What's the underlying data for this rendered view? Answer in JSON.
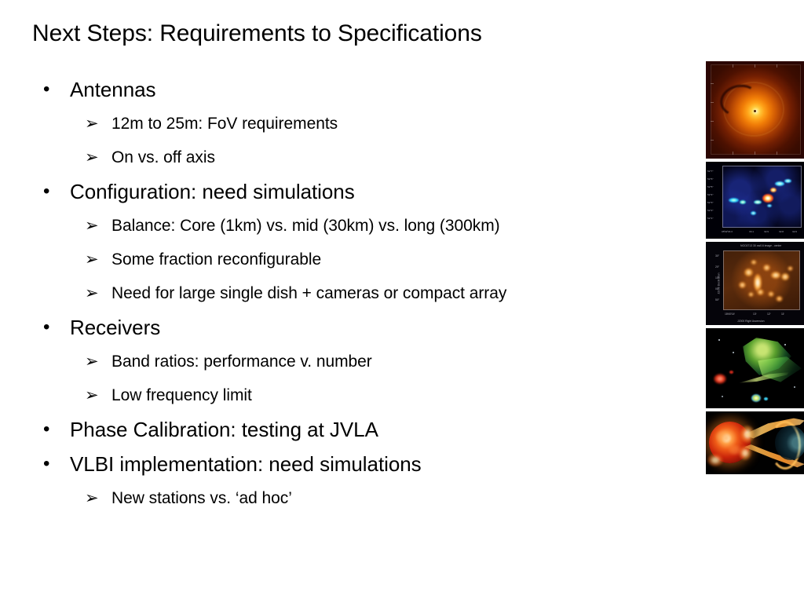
{
  "slide": {
    "title": "Next Steps: Requirements to Specifications",
    "bullet_glyph": "•",
    "sub_bullet_glyph": "➢",
    "background_color": "#ffffff",
    "text_color": "#000000",
    "outline": [
      {
        "level": 1,
        "text": "Antennas"
      },
      {
        "level": 2,
        "text": "12m to 25m: FoV requirements"
      },
      {
        "level": 2,
        "text": "On vs. off axis"
      },
      {
        "level": 1,
        "text": "Configuration: need simulations"
      },
      {
        "level": 2,
        "text": "Balance: Core (1km) vs. mid (30km) vs. long (300km)"
      },
      {
        "level": 2,
        "text": "Some fraction reconfigurable"
      },
      {
        "level": 2,
        "text": "Need for large single dish + cameras or compact array"
      },
      {
        "level": 1,
        "text": "Receivers"
      },
      {
        "level": 2,
        "text": "Band ratios: performance v. number"
      },
      {
        "level": 2,
        "text": "Low frequency limit"
      },
      {
        "level": 1,
        "text": "Phase Calibration: testing at JVLA"
      },
      {
        "level": 1,
        "text": "VLBI implementation: need simulations"
      },
      {
        "level": 2,
        "text": "New stations vs. ‘ad hoc’"
      }
    ]
  },
  "image_strip": {
    "figures": [
      {
        "name": "protoplanetary-disk",
        "description": "Protoplanetary disk: bright yellow-white core with orange rings and a dark spiral gap",
        "dominant_colors": [
          "#ffe67a",
          "#ffa218",
          "#a33a03",
          "#300901"
        ]
      },
      {
        "name": "blue-interferometry-map",
        "description": "Radio interferometry map: dark blue noise field with bright cyan, green and red knots along a diagonal",
        "dominant_colors": [
          "#04061e",
          "#2244b0",
          "#35e0ff",
          "#ff3a2a"
        ]
      },
      {
        "name": "orange-continuum-map",
        "description": "Continuum map of a star forming region with bright orange clumps, J2000 coordinate axes",
        "axis_labels": {
          "y": "J2000 Declination",
          "x": "J2000 Right Ascension"
        },
        "dominant_colors": [
          "#3a1a07",
          "#c2681c",
          "#ffd08a"
        ]
      },
      {
        "name": "green-filament-nebula",
        "description": "Black field with a green and yellow wispy filamentary nebula plus red and blue knots",
        "dominant_colors": [
          "#000000",
          "#6fd83a",
          "#d8e64a",
          "#e03a2a",
          "#3aa8e0"
        ]
      },
      {
        "name": "star-jet-artist-impression",
        "description": "Artist impression: red-orange glowing star on the left streaming orange material toward a dark companion with a blue rim",
        "dominant_colors": [
          "#c9240a",
          "#ff9f45",
          "#ffdca8",
          "#78d2e1"
        ]
      }
    ]
  }
}
